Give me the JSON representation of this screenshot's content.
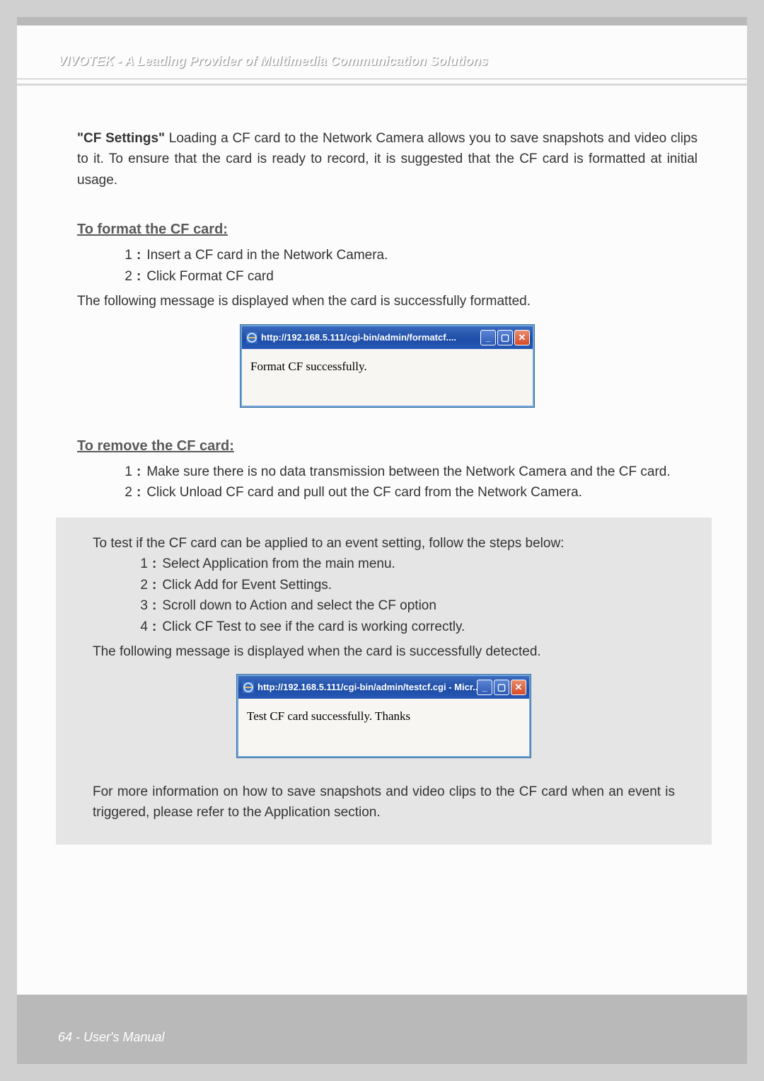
{
  "header": "VIVOTEK - A Leading Provider of Multimedia Communication Solutions",
  "intro_label": "\"CF Settings\"",
  "intro_text": " Loading a CF card to the Network Camera allows you to save snapshots and video clips to it. To ensure that the card is ready to record, it is suggested that the CF card is formatted at initial usage.",
  "format_heading": "To format the CF card:",
  "format_steps": [
    "Insert a CF card in the Network Camera.",
    "Click Format CF card"
  ],
  "format_success_msg": "The following message is displayed when the card is successfully formatted.",
  "dialog1": {
    "title": "http://192.168.5.111/cgi-bin/admin/formatcf....",
    "body": "Format CF successfully."
  },
  "remove_heading": "To remove the CF card:",
  "remove_steps": [
    "Make sure there is no data transmission between the Network Camera and the CF card.",
    "Click Unload CF card and pull out the CF card from the Network Camera."
  ],
  "graybox": {
    "intro": "To test if the CF card can be applied to an event setting, follow the steps below:",
    "steps": [
      "Select Application from the main menu.",
      "Click Add for Event Settings.",
      "Scroll down to Action and select the CF option",
      "Click CF Test to see if the card is working correctly."
    ],
    "success_msg": "The following message is displayed when the card is successfully detected.",
    "dialog2": {
      "title": "http://192.168.5.111/cgi-bin/admin/testcf.cgi - Micr...",
      "body": "Test CF card successfully. Thanks"
    },
    "followup": "For more information on how to save snapshots and video clips to the CF card when an event is triggered, please refer to the Application section."
  },
  "footer": "64 - User's Manual",
  "win_buttons": {
    "min": "_",
    "max": "▢",
    "close": "✕"
  }
}
